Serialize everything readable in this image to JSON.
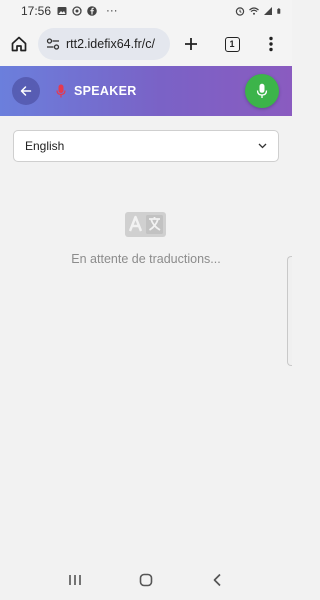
{
  "status_bar": {
    "time": "17:56",
    "overflow": "···",
    "icons_left": [
      "image-icon",
      "sync-icon",
      "facebook-icon"
    ],
    "icons_right": [
      "alarm-icon",
      "wifi-icon",
      "signal-icon",
      "battery-icon"
    ]
  },
  "browser": {
    "url": "rtt2.idefix64.fr/c/",
    "tab_count": "1",
    "icons": [
      "home-icon",
      "site-settings-icon",
      "plus-icon",
      "tabs-icon",
      "more-vert-icon"
    ]
  },
  "header": {
    "title": "SPEAKER",
    "back_icon": "arrow-left-icon",
    "speaker_icon": "microphone-icon",
    "mic_icon": "microphone-icon",
    "colors": {
      "gradient_start": "#6b7fdc",
      "gradient_end": "#8a5bc0",
      "mic_button": "#3cb44a",
      "speaker_icon": "#e53950"
    }
  },
  "language_select": {
    "selected": "English"
  },
  "empty_state": {
    "icon": "translate-icon",
    "message": "En attente de traductions..."
  },
  "nav_bar": {
    "icons": [
      "recents-icon",
      "home-circle-icon",
      "back-chevron-icon"
    ]
  }
}
